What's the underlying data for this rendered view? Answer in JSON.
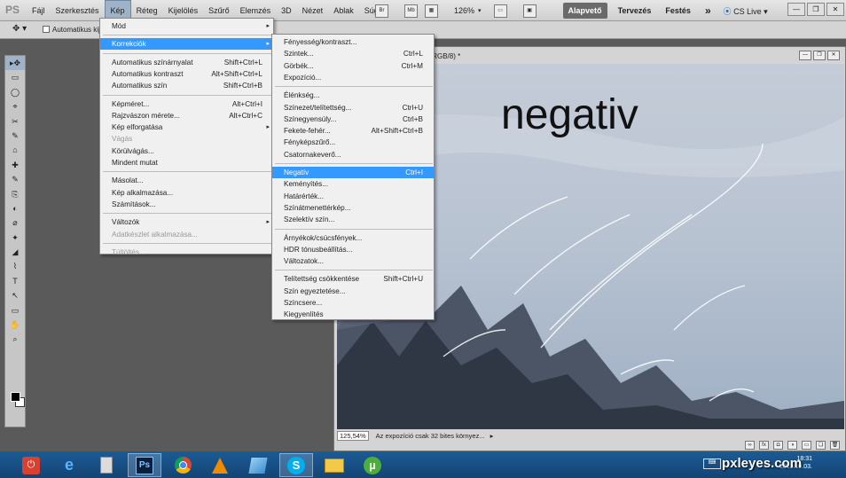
{
  "app": {
    "logo": "PS"
  },
  "menubar": {
    "items": [
      "Fájl",
      "Szerkesztés",
      "Kép",
      "Réteg",
      "Kijelölés",
      "Szűrő",
      "Elemzés",
      "3D",
      "Nézet",
      "Ablak",
      "Súgó"
    ],
    "active_index": 2
  },
  "toolbar_right": {
    "btn1": "Br",
    "btn2": "Mb",
    "zoom": "126%",
    "workspaces": [
      "Alapvető",
      "Tervezés",
      "Festés"
    ],
    "more": "»",
    "cslive": "CS Live ▾"
  },
  "options_bar": {
    "checkbox_label": "Automatikus kij"
  },
  "document": {
    "title_fragment": ",RGB/8) *",
    "overlay_text": "negativ",
    "status_zoom": "125,54%",
    "status_info": "Az expozíció csak 32 bites környez..."
  },
  "kep_menu": [
    {
      "label": "Mód",
      "arrow": true
    },
    {
      "sep": true
    },
    {
      "label": "Korrekciók",
      "arrow": true,
      "highlight": true
    },
    {
      "sep": true
    },
    {
      "label": "Automatikus színárnyalat",
      "shortcut": "Shift+Ctrl+L"
    },
    {
      "label": "Automatikus kontraszt",
      "shortcut": "Alt+Shift+Ctrl+L"
    },
    {
      "label": "Automatikus szín",
      "shortcut": "Shift+Ctrl+B"
    },
    {
      "sep": true
    },
    {
      "label": "Képméret...",
      "shortcut": "Alt+Ctrl+I"
    },
    {
      "label": "Rajzvászon mérete...",
      "shortcut": "Alt+Ctrl+C"
    },
    {
      "label": "Kép elforgatása",
      "arrow": true
    },
    {
      "label": "Vágás",
      "disabled": true
    },
    {
      "label": "Körülvágás..."
    },
    {
      "label": "Mindent mutat"
    },
    {
      "sep": true
    },
    {
      "label": "Másolat..."
    },
    {
      "label": "Kép alkalmazása..."
    },
    {
      "label": "Számítások..."
    },
    {
      "sep": true
    },
    {
      "label": "Változók",
      "arrow": true
    },
    {
      "label": "Adatkészlet alkalmazása...",
      "disabled": true
    },
    {
      "sep": true
    },
    {
      "label": "Túltöltés...",
      "disabled": true
    }
  ],
  "korrekciok_menu": [
    {
      "label": "Fényesség/kontraszt..."
    },
    {
      "label": "Szintek...",
      "shortcut": "Ctrl+L"
    },
    {
      "label": "Görbék...",
      "shortcut": "Ctrl+M"
    },
    {
      "label": "Expozíció..."
    },
    {
      "sep": true
    },
    {
      "label": "Élénkség..."
    },
    {
      "label": "Színezet/telítettség...",
      "shortcut": "Ctrl+U"
    },
    {
      "label": "Színegyensúly...",
      "shortcut": "Ctrl+B"
    },
    {
      "label": "Fekete-fehér...",
      "shortcut": "Alt+Shift+Ctrl+B"
    },
    {
      "label": "Fényképszűrő..."
    },
    {
      "label": "Csatornakeverő..."
    },
    {
      "sep": true
    },
    {
      "label": "Negatív",
      "shortcut": "Ctrl+I",
      "highlight": true
    },
    {
      "label": "Keményítés..."
    },
    {
      "label": "Határérték..."
    },
    {
      "label": "Színátmenettérkép..."
    },
    {
      "label": "Szelektív szín..."
    },
    {
      "sep": true
    },
    {
      "label": "Árnyékok/csúcsfények..."
    },
    {
      "label": "HDR tónusbeállítás..."
    },
    {
      "label": "Változatok..."
    },
    {
      "sep": true
    },
    {
      "label": "Telítettség csökkentése",
      "shortcut": "Shift+Ctrl+U"
    },
    {
      "label": "Szín egyeztetése..."
    },
    {
      "label": "Színcsere..."
    },
    {
      "label": "Kiegyenlítés"
    }
  ],
  "taskbar": {
    "icons": [
      "power-icon",
      "ie-icon",
      "calculator-icon",
      "photoshop-icon",
      "chrome-icon",
      "vlc-icon",
      "notes-icon",
      "skype-icon",
      "explorer-icon",
      "utorrent-icon"
    ],
    "ps_label": "Ps",
    "skype_label": "S",
    "utorrent_label": "µ",
    "clock_time": "18:31",
    "clock_date": "2013.10.03."
  },
  "watermark": "pxleyes.com"
}
